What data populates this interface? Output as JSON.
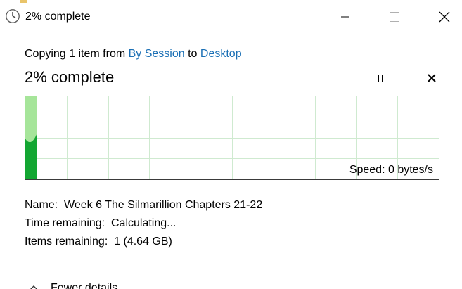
{
  "window": {
    "title": "2% complete"
  },
  "header": {
    "copying_prefix": "Copying 1 item from ",
    "source": "By Session",
    "to_word": " to ",
    "destination": "Desktop"
  },
  "status": {
    "percent_text": "2% complete",
    "percent_value": 2
  },
  "graph": {
    "speed_label": "Speed: 0 bytes/s",
    "colors": {
      "fill_light": "#a6e59a",
      "fill_dark": "#13a632",
      "grid": "#cfead0"
    }
  },
  "details": {
    "name_label": "Name:",
    "name_value": "Week 6 The Silmarillion Chapters 21-22",
    "time_label": "Time remaining:",
    "time_value": "Calculating...",
    "items_label": "Items remaining:",
    "items_value": "1 (4.64 GB)"
  },
  "footer": {
    "fewer_details": "Fewer details"
  },
  "icons": {
    "title": "clock-icon",
    "minimize": "minimize-icon",
    "maximize": "maximize-icon",
    "close": "close-icon",
    "pause": "pause-icon",
    "stop": "stop-icon",
    "collapse": "chevron-up-icon"
  }
}
